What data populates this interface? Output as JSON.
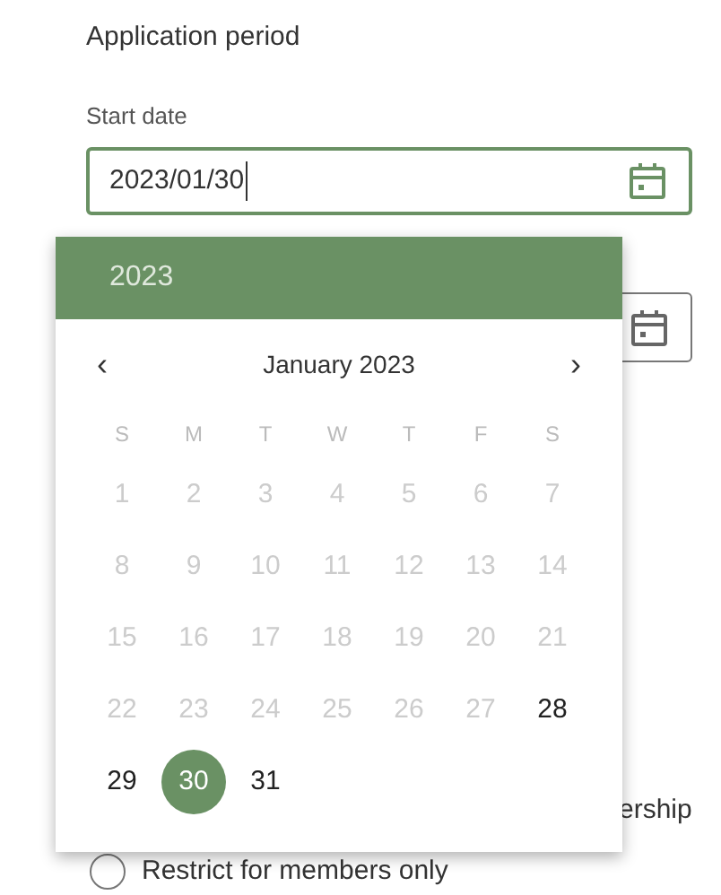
{
  "section": {
    "title": "Application period"
  },
  "start_date": {
    "label": "Start date",
    "value": "2023/01/30",
    "focused": true
  },
  "end_date": {
    "focused": false
  },
  "date_picker": {
    "year": "2023",
    "prev": "‹",
    "next": "›",
    "month": "January 2023",
    "weekdays": [
      "S",
      "M",
      "T",
      "W",
      "T",
      "F",
      "S"
    ],
    "days": [
      {
        "label": "1",
        "disabled": true,
        "selected": false
      },
      {
        "label": "2",
        "disabled": true,
        "selected": false
      },
      {
        "label": "3",
        "disabled": true,
        "selected": false
      },
      {
        "label": "4",
        "disabled": true,
        "selected": false
      },
      {
        "label": "5",
        "disabled": true,
        "selected": false
      },
      {
        "label": "6",
        "disabled": true,
        "selected": false
      },
      {
        "label": "7",
        "disabled": true,
        "selected": false
      },
      {
        "label": "8",
        "disabled": true,
        "selected": false
      },
      {
        "label": "9",
        "disabled": true,
        "selected": false
      },
      {
        "label": "10",
        "disabled": true,
        "selected": false
      },
      {
        "label": "11",
        "disabled": true,
        "selected": false
      },
      {
        "label": "12",
        "disabled": true,
        "selected": false
      },
      {
        "label": "13",
        "disabled": true,
        "selected": false
      },
      {
        "label": "14",
        "disabled": true,
        "selected": false
      },
      {
        "label": "15",
        "disabled": true,
        "selected": false
      },
      {
        "label": "16",
        "disabled": true,
        "selected": false
      },
      {
        "label": "17",
        "disabled": true,
        "selected": false
      },
      {
        "label": "18",
        "disabled": true,
        "selected": false
      },
      {
        "label": "19",
        "disabled": true,
        "selected": false
      },
      {
        "label": "20",
        "disabled": true,
        "selected": false
      },
      {
        "label": "21",
        "disabled": true,
        "selected": false
      },
      {
        "label": "22",
        "disabled": true,
        "selected": false
      },
      {
        "label": "23",
        "disabled": true,
        "selected": false
      },
      {
        "label": "24",
        "disabled": true,
        "selected": false
      },
      {
        "label": "25",
        "disabled": true,
        "selected": false
      },
      {
        "label": "26",
        "disabled": true,
        "selected": false
      },
      {
        "label": "27",
        "disabled": true,
        "selected": false
      },
      {
        "label": "28",
        "disabled": false,
        "selected": false
      },
      {
        "label": "29",
        "disabled": false,
        "selected": false
      },
      {
        "label": "30",
        "disabled": false,
        "selected": true
      },
      {
        "label": "31",
        "disabled": false,
        "selected": false
      }
    ]
  },
  "options": [
    {
      "label": "ership"
    },
    {
      "label": "Restrict for members only",
      "selected": false
    }
  ]
}
